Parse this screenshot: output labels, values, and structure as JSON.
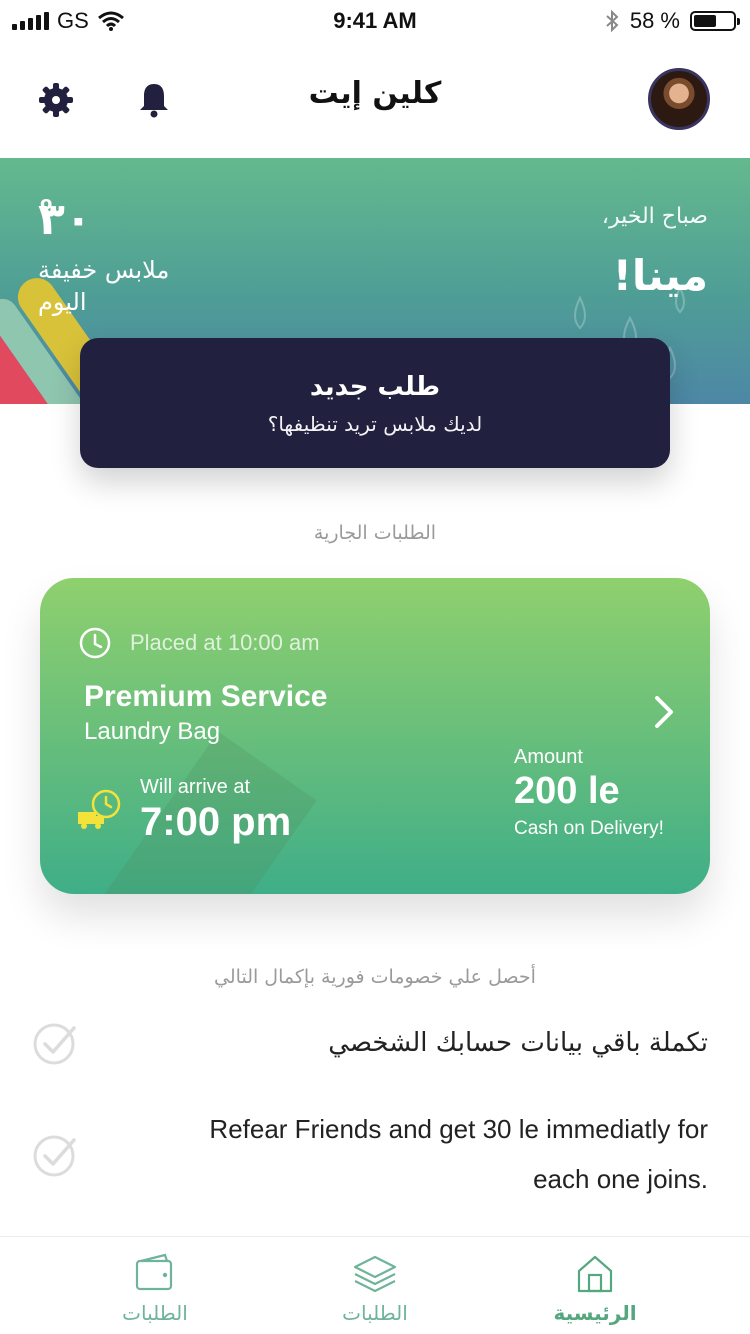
{
  "status_bar": {
    "carrier": "GS",
    "time": "9:41 AM",
    "battery_percent": "58 %",
    "battery_level": 0.58
  },
  "header": {
    "title": "كلين إيت",
    "gear_icon": "gear-icon",
    "bell_icon": "bell-icon",
    "avatar": "user-avatar"
  },
  "hero": {
    "greeting": "صباح الخير،",
    "user_name": "مينا!",
    "temperature": "٣٠",
    "degree_symbol": "o",
    "weather_text": "ملابس خفيفة اليوم",
    "colors": {
      "top": "#64b98e",
      "bottom": "#4d87a6"
    }
  },
  "new_order": {
    "title": "طلب جديد",
    "subtitle": "لديك ملابس تريد تنظيفها؟",
    "color": "#21203f"
  },
  "current_orders": {
    "label": "الطلبات الجارية",
    "order": {
      "placed": "Placed at 10:00 am",
      "service": "Premium Service",
      "type": "Laundry Bag",
      "arrive_label": "Will arrive at",
      "arrive_time": "7:00 pm",
      "amount_label": "Amount",
      "amount": "200 le",
      "payment": "Cash on Delivery!"
    }
  },
  "discounts": {
    "label": "أحصل علي خصومات فورية بإكمال التالي",
    "tasks": [
      {
        "text": "تكملة باقي بيانات حسابك الشخصي"
      },
      {
        "line1": "Refear Friends and get 30 le immediatly for",
        "line2": "each one joins."
      }
    ]
  },
  "tabs": [
    {
      "label": "الطلبات",
      "icon": "wallet-icon"
    },
    {
      "label": "الطلبات",
      "icon": "layers-icon"
    },
    {
      "label": "الرئيسية",
      "icon": "home-icon",
      "active": true
    }
  ],
  "accent_color": "#55a780"
}
